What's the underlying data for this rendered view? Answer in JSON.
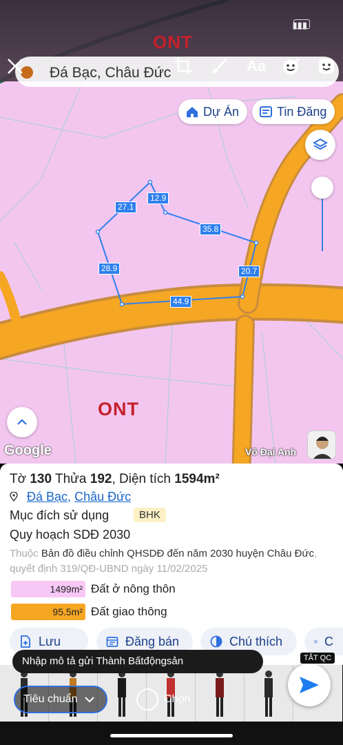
{
  "map": {
    "search_text": "Đá Bạc, Châu Đức",
    "top_zone_label": "ONT",
    "zone_label": "ONT",
    "pills": {
      "projects": "Dự Án",
      "listings": "Tin Đăng"
    },
    "dimensions": [
      "27.1",
      "12.9",
      "35.8",
      "28.9",
      "20.7",
      "44.9"
    ],
    "google_label": "Google",
    "author": "Võ Đại Anh",
    "status_text": "▮▮▮"
  },
  "editor_toolbar": {
    "text_label": "Aa"
  },
  "parcel": {
    "title_prefix": "Tờ",
    "sheet_no": "130",
    "parcel_label": "Thửa",
    "parcel_no": "192",
    "area_label": ", Diện tích",
    "area_value": "1594m²",
    "commune": "Đá Bạc",
    "separator": ",",
    "district": "Châu Đức",
    "purpose_label": "Mục đích sử dụng",
    "purpose_badge": "BHK",
    "plan_title": "Quy hoạch SDĐ 2030",
    "note_prefix": "Thuộc",
    "note_main": "Bản đồ điều chỉnh QHSDĐ đến năm 2030 huyện Châu Đức",
    "note_suffix": ", quyết định 319/QĐ-UBND ngày 11/02/2025",
    "legend": [
      {
        "value": "1499m²",
        "label": "Đất ở nông thôn",
        "color": "#f7c8f6"
      },
      {
        "value": "95.5m²",
        "label": "Đất giao thông",
        "color": "#f5a623"
      }
    ]
  },
  "actions": {
    "save": "Lưu",
    "post": "Đăng bán",
    "legend": "Chú thích",
    "more": "C"
  },
  "composer": {
    "input_text": "Nhập mô tả gửi Thành Bấtđộngsản",
    "tat_qc": "TẮT QC",
    "mode": "Tiêu chuẩn",
    "choose": "Chọn"
  },
  "colors": {
    "zone_pink": "#f3c6f0",
    "road_orange": "#f5a623",
    "accent_blue": "#2f6fe0",
    "link_blue": "#1a66c8"
  }
}
